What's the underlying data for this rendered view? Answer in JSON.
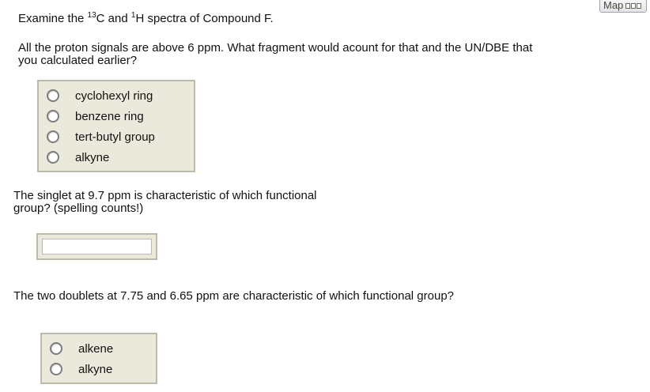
{
  "toolbar": {
    "map_label": "Map",
    "map_icon": "map-icon"
  },
  "q1": {
    "intro_prefix": "Examine the ",
    "sup_c": "13",
    "c_and": "C and ",
    "sup_h": "1",
    "h_suffix": "H spectra of Compound F."
  },
  "q2": {
    "line1": "All the proton signals are above 6 ppm. What fragment would acount for that and the UN/DBE that",
    "line2": "you calculated earlier?",
    "options": [
      "cyclohexyl ring",
      "benzene ring",
      "tert-butyl group",
      "alkyne"
    ]
  },
  "q3": {
    "line1": "The singlet at 9.7 ppm is characteristic of which functional",
    "line2": "group? (spelling counts!)",
    "input_value": ""
  },
  "q4": {
    "line1": "The two doublets at 7.75 and 6.65 ppm are characteristic of which functional group?",
    "options": [
      "alkene",
      "alkyne"
    ]
  }
}
